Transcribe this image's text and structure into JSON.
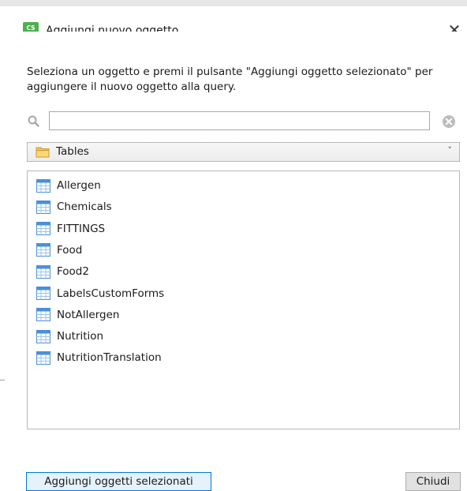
{
  "window": {
    "title": "Aggiungi nuovo oggetto",
    "close_glyph": "✕",
    "app_icon": "cs-app-icon"
  },
  "description": "Seleziona un oggetto e premi il pulsante \"Aggiungi oggetto selezionato\" per aggiungere il nuovo oggetto alla query.",
  "search": {
    "value": "",
    "placeholder": "",
    "icon": "search-icon",
    "clear_icon": "clear-icon"
  },
  "folder_select": {
    "value": "Tables",
    "icon": "folder-icon",
    "chevron": "˅"
  },
  "objects": {
    "item_icon": "table-icon",
    "items": [
      "Allergen",
      "Chemicals",
      "FITTINGS",
      "Food",
      "Food2",
      "LabelsCustomForms",
      "NotAllergen",
      "Nutrition",
      "NutritionTranslation"
    ]
  },
  "buttons": {
    "add_label": "Aggiungi oggetti selezionati",
    "close_label": "Chiudi"
  },
  "colors": {
    "accent": "#0078d7",
    "app_icon_green": "#4caf50"
  }
}
